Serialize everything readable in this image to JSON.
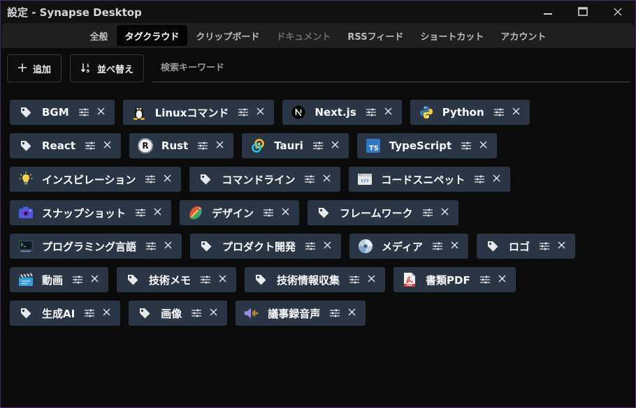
{
  "window": {
    "title": "設定 - Synapse Desktop"
  },
  "tabs": [
    {
      "id": "general",
      "label": "全般",
      "state": "normal"
    },
    {
      "id": "tagcloud",
      "label": "タグクラウド",
      "state": "active"
    },
    {
      "id": "clipboard",
      "label": "クリップボード",
      "state": "normal"
    },
    {
      "id": "documents",
      "label": "ドキュメント",
      "state": "disabled"
    },
    {
      "id": "rss",
      "label": "RSSフィード",
      "state": "normal"
    },
    {
      "id": "shortcuts",
      "label": "ショートカット",
      "state": "normal"
    },
    {
      "id": "account",
      "label": "アカウント",
      "state": "normal"
    }
  ],
  "toolbar": {
    "add_label": "追加",
    "sort_label": "並べ替え",
    "search_placeholder": "検索キーワード",
    "search_value": ""
  },
  "tags": [
    {
      "name": "BGM",
      "icon": "tag-icon"
    },
    {
      "name": "Linuxコマンド",
      "icon": "tux-icon"
    },
    {
      "name": "Next.js",
      "icon": "nextjs-icon"
    },
    {
      "name": "Python",
      "icon": "python-icon"
    },
    {
      "name": "React",
      "icon": "tag-icon"
    },
    {
      "name": "Rust",
      "icon": "rust-icon"
    },
    {
      "name": "Tauri",
      "icon": "tauri-icon"
    },
    {
      "name": "TypeScript",
      "icon": "typescript-icon"
    },
    {
      "name": "インスピレーション",
      "icon": "lightbulb-icon"
    },
    {
      "name": "コマンドライン",
      "icon": "tag-icon"
    },
    {
      "name": "コードスニペット",
      "icon": "code-window-icon"
    },
    {
      "name": "スナップショット",
      "icon": "camera-icon"
    },
    {
      "name": "デザイン",
      "icon": "palette-icon"
    },
    {
      "name": "フレームワーク",
      "icon": "tag-icon"
    },
    {
      "name": "プログラミング言語",
      "icon": "terminal-icon"
    },
    {
      "name": "プロダクト開発",
      "icon": "tag-icon"
    },
    {
      "name": "メディア",
      "icon": "disc-icon"
    },
    {
      "name": "ロゴ",
      "icon": "tag-icon"
    },
    {
      "name": "動画",
      "icon": "clapperboard-icon"
    },
    {
      "name": "技術メモ",
      "icon": "tag-icon"
    },
    {
      "name": "技術情報収集",
      "icon": "tag-icon"
    },
    {
      "name": "書類PDF",
      "icon": "pdf-icon"
    },
    {
      "name": "生成AI",
      "icon": "tag-icon"
    },
    {
      "name": "画像",
      "icon": "tag-icon"
    },
    {
      "name": "議事録音声",
      "icon": "speaker-icon"
    }
  ],
  "colors": {
    "background": "#0b0b0b",
    "tabbar": "#1f1f1f",
    "tag_chip": "#2a3545",
    "window_border": "#4a2a6a"
  }
}
